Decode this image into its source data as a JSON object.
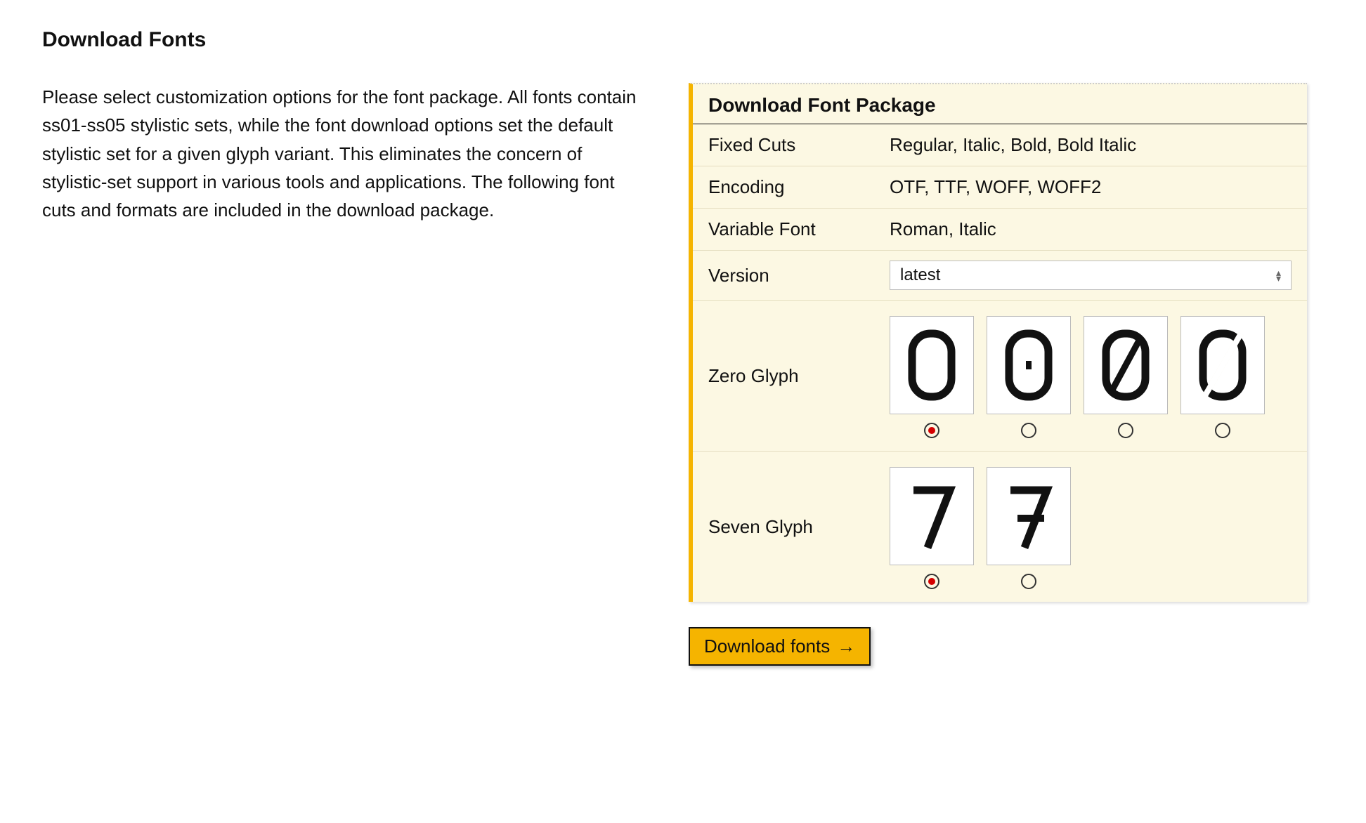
{
  "page": {
    "title": "Download Fonts",
    "intro": "Please select customization options for the font package. All fonts contain ss01-ss05 stylistic sets, while the font download options set the default stylistic set for a given glyph variant. This eliminates the concern of stylistic-set support in various tools and applications. The following font cuts and formats are included in the download package."
  },
  "panel": {
    "title": "Download Font Package",
    "rows": {
      "fixed_cuts": {
        "label": "Fixed Cuts",
        "value": "Regular, Italic, Bold, Bold Italic"
      },
      "encoding": {
        "label": "Encoding",
        "value": "OTF, TTF, WOFF, WOFF2"
      },
      "variable_font": {
        "label": "Variable Font",
        "value": "Roman, Italic"
      },
      "version": {
        "label": "Version",
        "selected": "latest"
      },
      "zero_glyph": {
        "label": "Zero Glyph",
        "selected_index": 0,
        "option_count": 4
      },
      "seven_glyph": {
        "label": "Seven Glyph",
        "selected_index": 0,
        "option_count": 2
      }
    }
  },
  "button": {
    "download": "Download fonts"
  }
}
